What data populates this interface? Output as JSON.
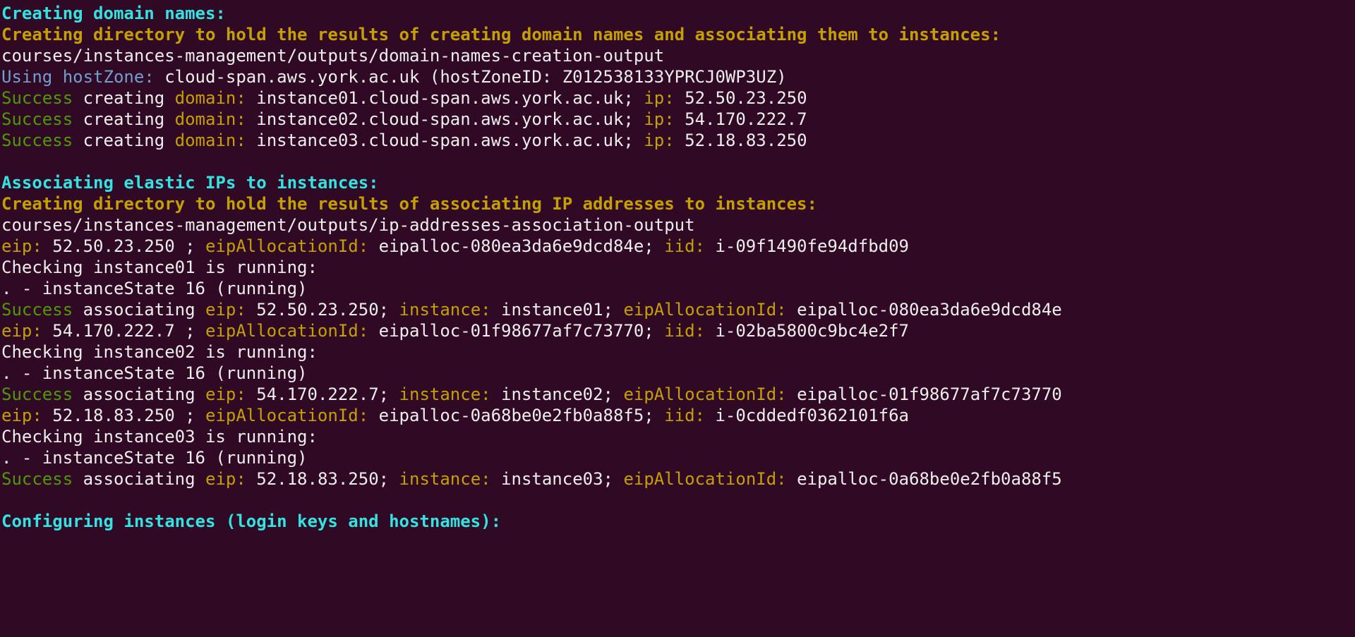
{
  "s1_header": "Creating domain names:",
  "s1_subheader": "Creating directory to hold the results of creating domain names and associating them to instances:",
  "s1_path": "courses/instances-management/outputs/domain-names-creation-output",
  "s1_hz_label": "Using hostZone: ",
  "s1_hz_value": "cloud-span.aws.york.ac.uk (hostZoneID: Z012538133YPRCJ0WP3UZ)",
  "s1_domains": [
    {
      "success": "Success",
      "creating": " creating ",
      "domain_label": "domain:",
      "domain_val": " instance01.cloud-span.aws.york.ac.uk; ",
      "ip_label": "ip:",
      "ip_val": " 52.50.23.250"
    },
    {
      "success": "Success",
      "creating": " creating ",
      "domain_label": "domain:",
      "domain_val": " instance02.cloud-span.aws.york.ac.uk; ",
      "ip_label": "ip:",
      "ip_val": " 54.170.222.7"
    },
    {
      "success": "Success",
      "creating": " creating ",
      "domain_label": "domain:",
      "domain_val": " instance03.cloud-span.aws.york.ac.uk; ",
      "ip_label": "ip:",
      "ip_val": " 52.18.83.250"
    }
  ],
  "s2_header": "Associating elastic IPs to instances:",
  "s2_subheader": "Creating directory to hold the results of associating IP addresses to instances:",
  "s2_path": "courses/instances-management/outputs/ip-addresses-association-output",
  "s2_blocks": [
    {
      "eip_label": "eip:",
      "eip_val": " 52.50.23.250 ; ",
      "alloc_label": "eipAllocationId:",
      "alloc_val": " eipalloc-080ea3da6e9dcd84e; ",
      "iid_label": "iid:",
      "iid_val": " i-09f1490fe94dfbd09",
      "check": "Checking instance01 is running:",
      "state": ". - instanceState 16 (running)",
      "ok_success": "Success",
      "ok_assoc": " associating ",
      "ok_eip_label": "eip:",
      "ok_eip_val": " 52.50.23.250; ",
      "ok_inst_label": "instance:",
      "ok_inst_val": " instance01; ",
      "ok_alloc_label": "eipAllocationId:",
      "ok_alloc_val": " eipalloc-080ea3da6e9dcd84e"
    },
    {
      "eip_label": "eip:",
      "eip_val": " 54.170.222.7 ; ",
      "alloc_label": "eipAllocationId:",
      "alloc_val": " eipalloc-01f98677af7c73770; ",
      "iid_label": "iid:",
      "iid_val": " i-02ba5800c9bc4e2f7",
      "check": "Checking instance02 is running:",
      "state": ". - instanceState 16 (running)",
      "ok_success": "Success",
      "ok_assoc": " associating ",
      "ok_eip_label": "eip:",
      "ok_eip_val": " 54.170.222.7; ",
      "ok_inst_label": "instance:",
      "ok_inst_val": " instance02; ",
      "ok_alloc_label": "eipAllocationId:",
      "ok_alloc_val": " eipalloc-01f98677af7c73770"
    },
    {
      "eip_label": "eip:",
      "eip_val": " 52.18.83.250 ; ",
      "alloc_label": "eipAllocationId:",
      "alloc_val": " eipalloc-0a68be0e2fb0a88f5; ",
      "iid_label": "iid:",
      "iid_val": " i-0cddedf0362101f6a",
      "check": "Checking instance03 is running:",
      "state": ". - instanceState 16 (running)",
      "ok_success": "Success",
      "ok_assoc": " associating ",
      "ok_eip_label": "eip:",
      "ok_eip_val": " 52.18.83.250; ",
      "ok_inst_label": "instance:",
      "ok_inst_val": " instance03; ",
      "ok_alloc_label": "eipAllocationId:",
      "ok_alloc_val": " eipalloc-0a68be0e2fb0a88f5"
    }
  ],
  "s3_header": "Configuring instances (login keys and hostnames):"
}
